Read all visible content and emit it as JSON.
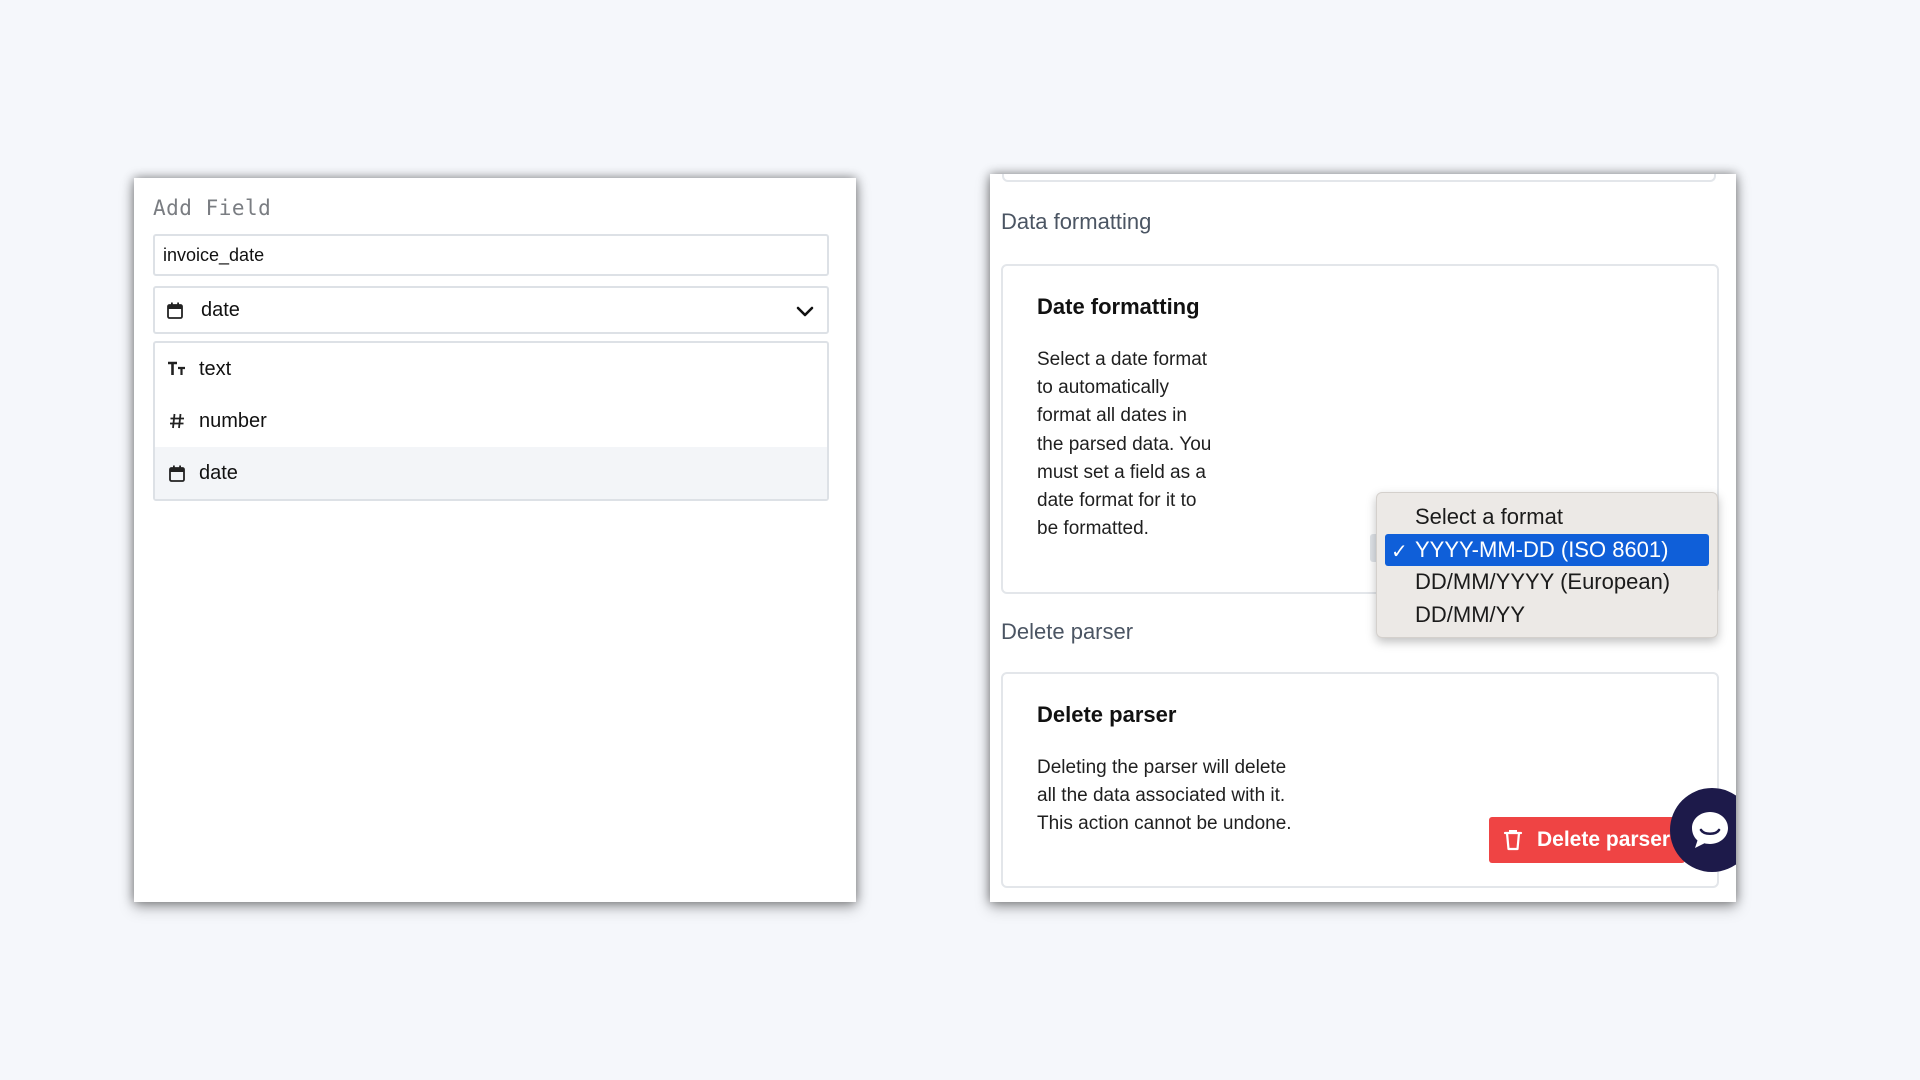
{
  "add_field": {
    "title": "Add Field",
    "name_value": "invoice_date",
    "selected_type": "date",
    "type_options": [
      {
        "label": "text",
        "icon": "text-type-icon"
      },
      {
        "label": "number",
        "icon": "hash-icon"
      },
      {
        "label": "date",
        "icon": "calendar-icon"
      }
    ]
  },
  "settings": {
    "data_formatting": {
      "section_title": "Data formatting",
      "card_title": "Date formatting",
      "description": "Select a date format to automatically format all dates in the parsed data. You must set a field as a date format for it to be formatted.",
      "dropdown": {
        "options": [
          "Select a format",
          "YYYY-MM-DD (ISO 8601)",
          "DD/MM/YYYY (European)",
          "DD/MM/YY"
        ],
        "selected": "YYYY-MM-DD (ISO 8601)",
        "selected_check": "✓"
      }
    },
    "delete_parser": {
      "section_title": "Delete parser",
      "card_title": "Delete parser",
      "description": "Deleting the parser will delete all the data associated with it. This action cannot be undone.",
      "button_label": "Delete parser"
    }
  },
  "colors": {
    "accent_blue": "#0f5fd9",
    "danger_red": "#ef4444",
    "chat_bubble": "#1d1a4a"
  }
}
